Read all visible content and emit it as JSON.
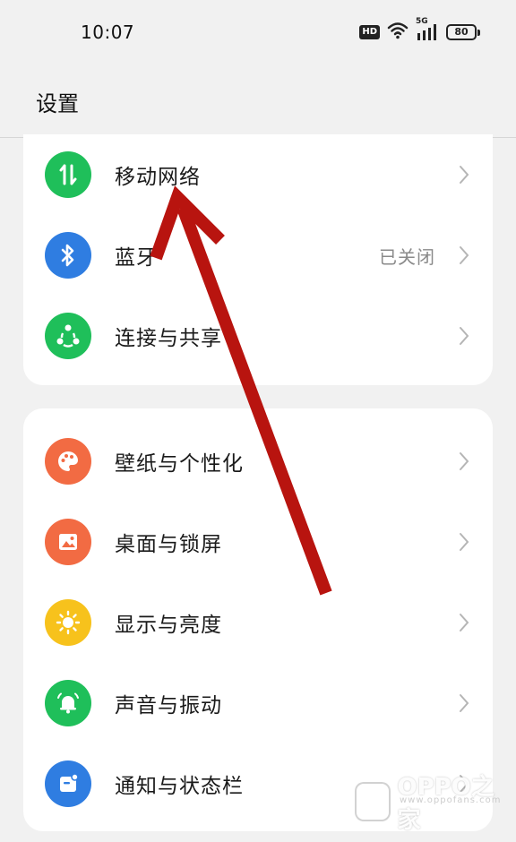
{
  "status_bar": {
    "time": "10:07",
    "hd": "HD",
    "network_type": "5G",
    "battery": "80"
  },
  "header": {
    "title": "设置"
  },
  "colors": {
    "mobile_network": "#1fbf5a",
    "bluetooth": "#2f7de1",
    "connection": "#1fbf5a",
    "wallpaper": "#f26b43",
    "desktop": "#f26b43",
    "display": "#f7c21c",
    "sound": "#1fbf5a",
    "notification": "#2f7de1",
    "arrow": "#b8140f"
  },
  "group1": [
    {
      "label": "移动网络",
      "value": "",
      "icon": "mobile-data-icon"
    },
    {
      "label": "蓝牙",
      "value": "已关闭",
      "icon": "bluetooth-icon"
    },
    {
      "label": "连接与共享",
      "value": "",
      "icon": "share-icon"
    }
  ],
  "group2": [
    {
      "label": "壁纸与个性化",
      "value": "",
      "icon": "palette-icon"
    },
    {
      "label": "桌面与锁屏",
      "value": "",
      "icon": "image-icon"
    },
    {
      "label": "显示与亮度",
      "value": "",
      "icon": "brightness-icon"
    },
    {
      "label": "声音与振动",
      "value": "",
      "icon": "bell-icon"
    },
    {
      "label": "通知与状态栏",
      "value": "",
      "icon": "notification-icon"
    }
  ],
  "watermark": {
    "text": "OPPO之家",
    "sub": "www.oppofans.com"
  }
}
